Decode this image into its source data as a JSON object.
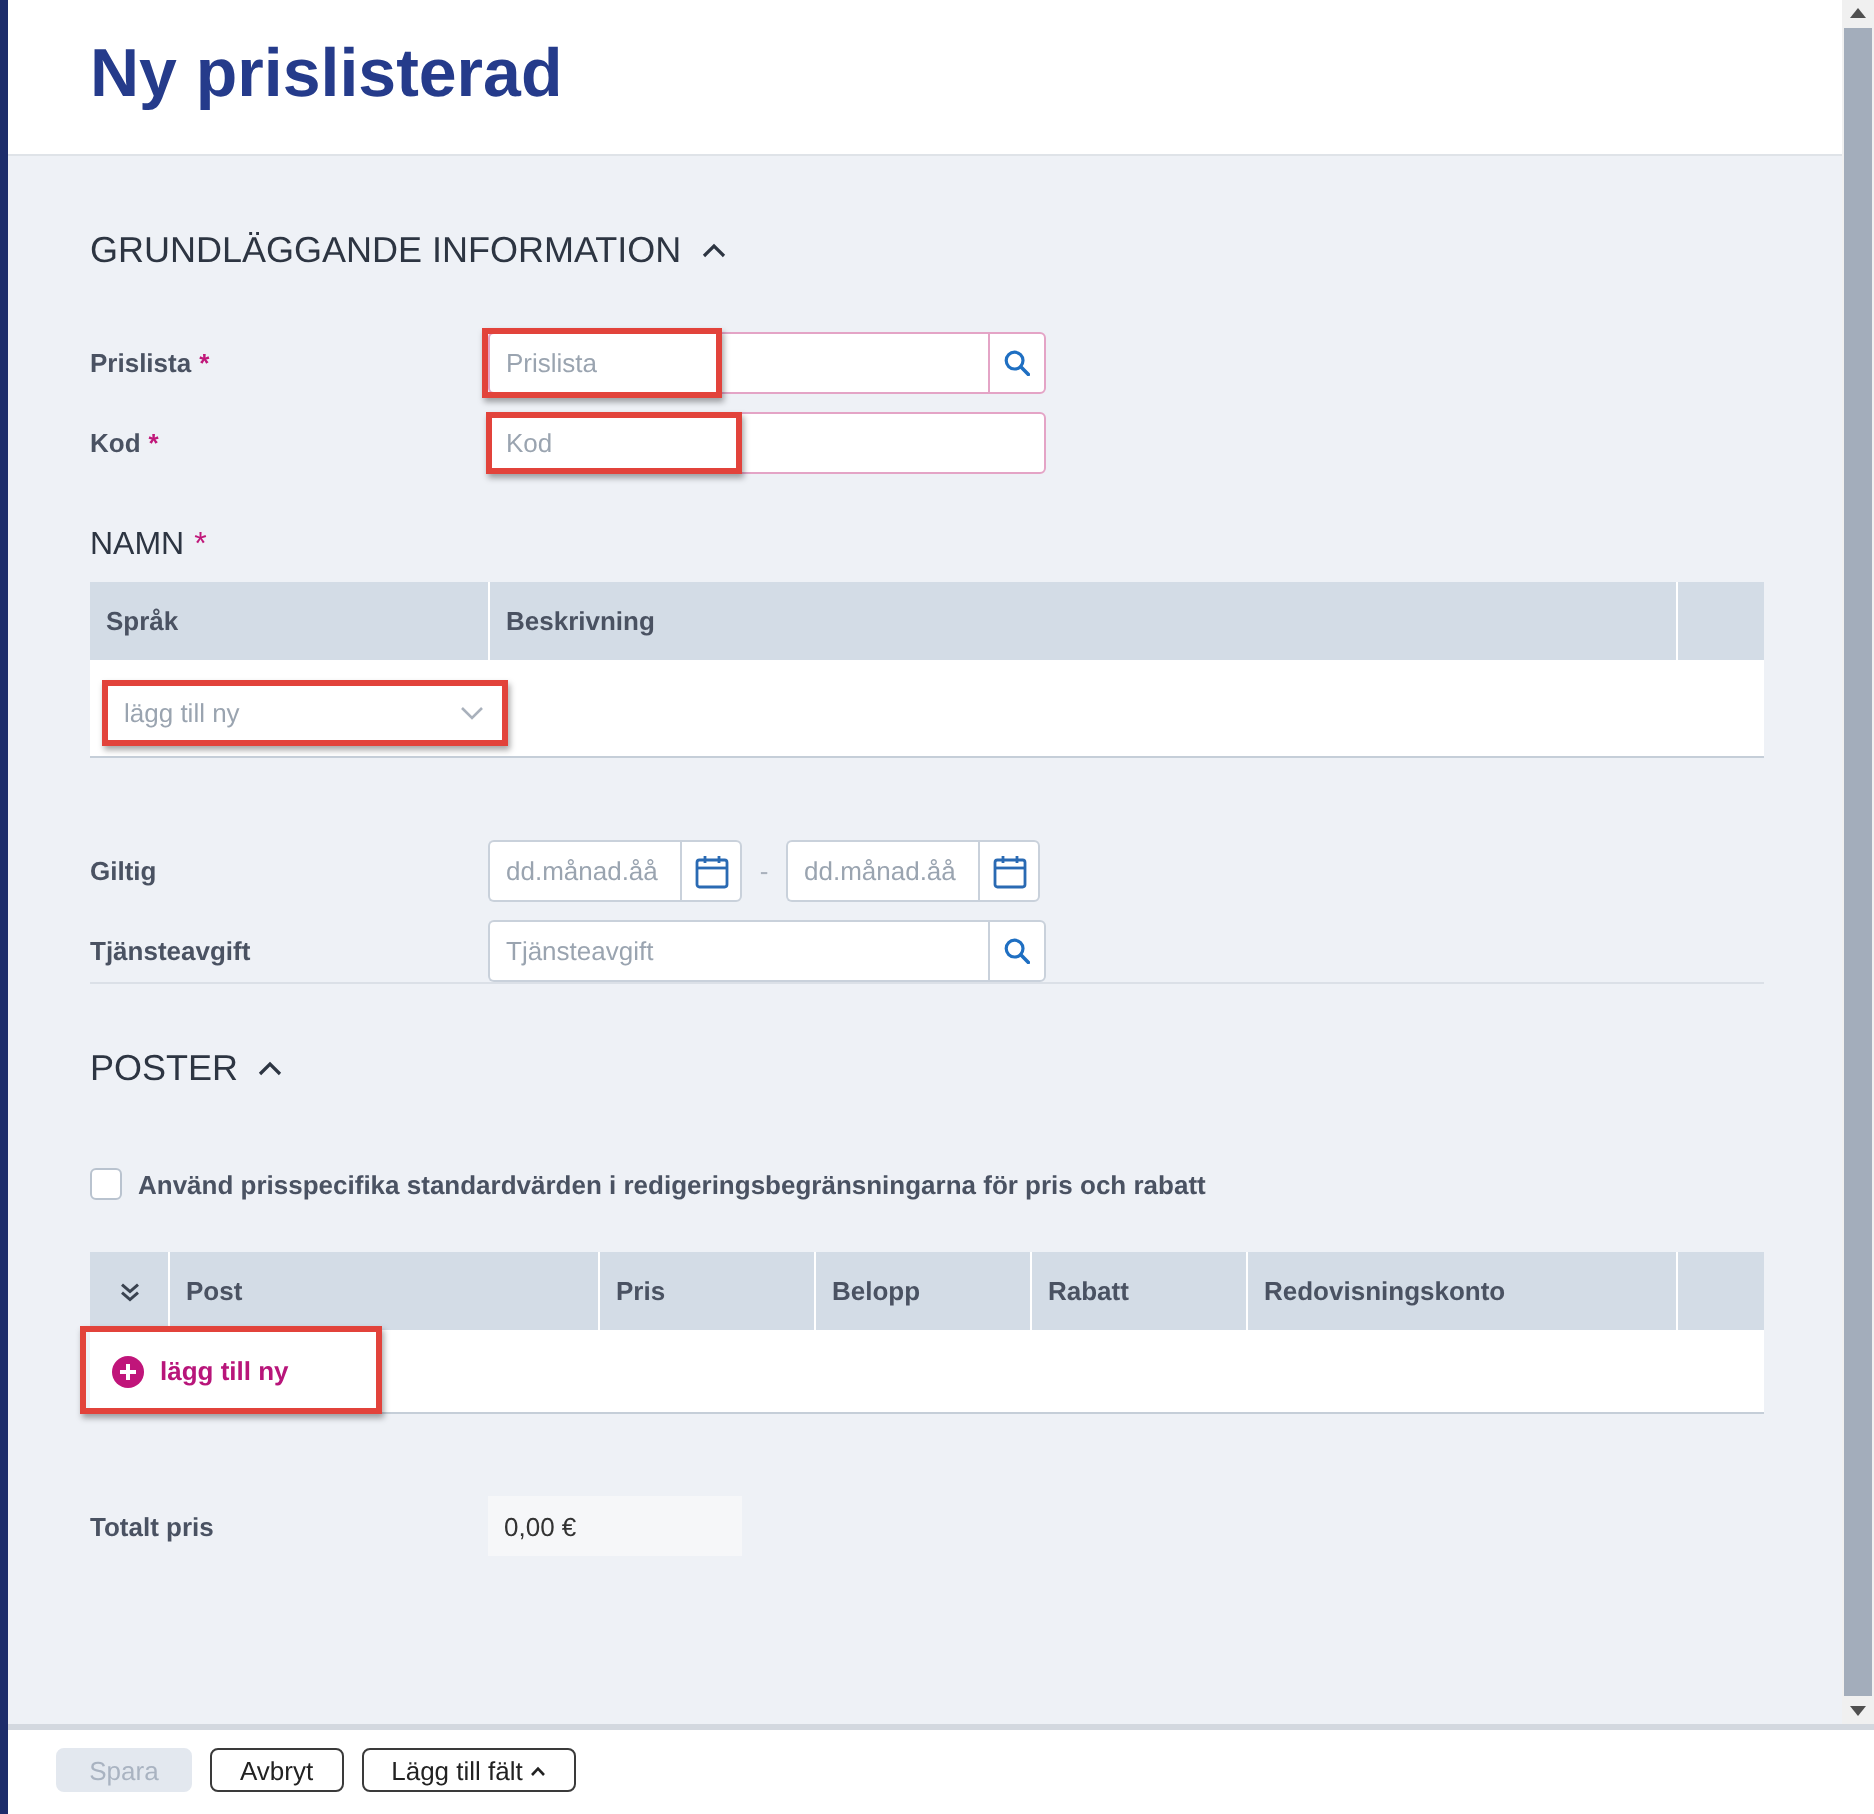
{
  "header": {
    "title": "Ny prislisterad"
  },
  "basic_info": {
    "heading": "GRUNDLÄGGANDE INFORMATION",
    "expanded": true,
    "fields": [
      {
        "kind": "lookup",
        "label": "Prislista",
        "required_mark": "*",
        "placeholder": "Prislista",
        "invalid": true,
        "highlighted": true
      },
      {
        "kind": "text",
        "label": "Kod",
        "required_mark": "*",
        "placeholder": "Kod",
        "invalid": true,
        "highlighted": true
      }
    ],
    "names": {
      "heading": "NAMN",
      "required_mark": "*",
      "columns": [
        "Språk",
        "Beskrivning"
      ],
      "add_select": {
        "placeholder": "lägg till ny",
        "highlighted": true
      }
    },
    "validity": {
      "label": "Giltig",
      "from": {
        "placeholder": "dd.månad.åå"
      },
      "separator": "-",
      "to": {
        "placeholder": "dd.månad.åå"
      }
    },
    "service_fee": {
      "kind": "lookup",
      "label": "Tjänsteavgift",
      "placeholder": "Tjänsteavgift",
      "invalid": false
    }
  },
  "postings": {
    "heading": "POSTER",
    "expanded": true,
    "checkbox": {
      "label": "Använd prisspecifika standardvärden i redigeringsbegränsningarna för pris och rabatt",
      "checked": false
    },
    "columns": [
      "Post",
      "Pris",
      "Belopp",
      "Rabatt",
      "Redovisningskonto"
    ],
    "add_button": {
      "label": "lägg till ny",
      "highlighted": true
    }
  },
  "total": {
    "label": "Totalt pris",
    "value": "0,00 €"
  },
  "footer": {
    "buttons": [
      {
        "kind": "plain",
        "label": "Spara",
        "disabled": true
      },
      {
        "kind": "plain",
        "label": "Avbryt",
        "disabled": false
      },
      {
        "kind": "menu",
        "label": "Lägg till fält",
        "disabled": false
      }
    ]
  }
}
